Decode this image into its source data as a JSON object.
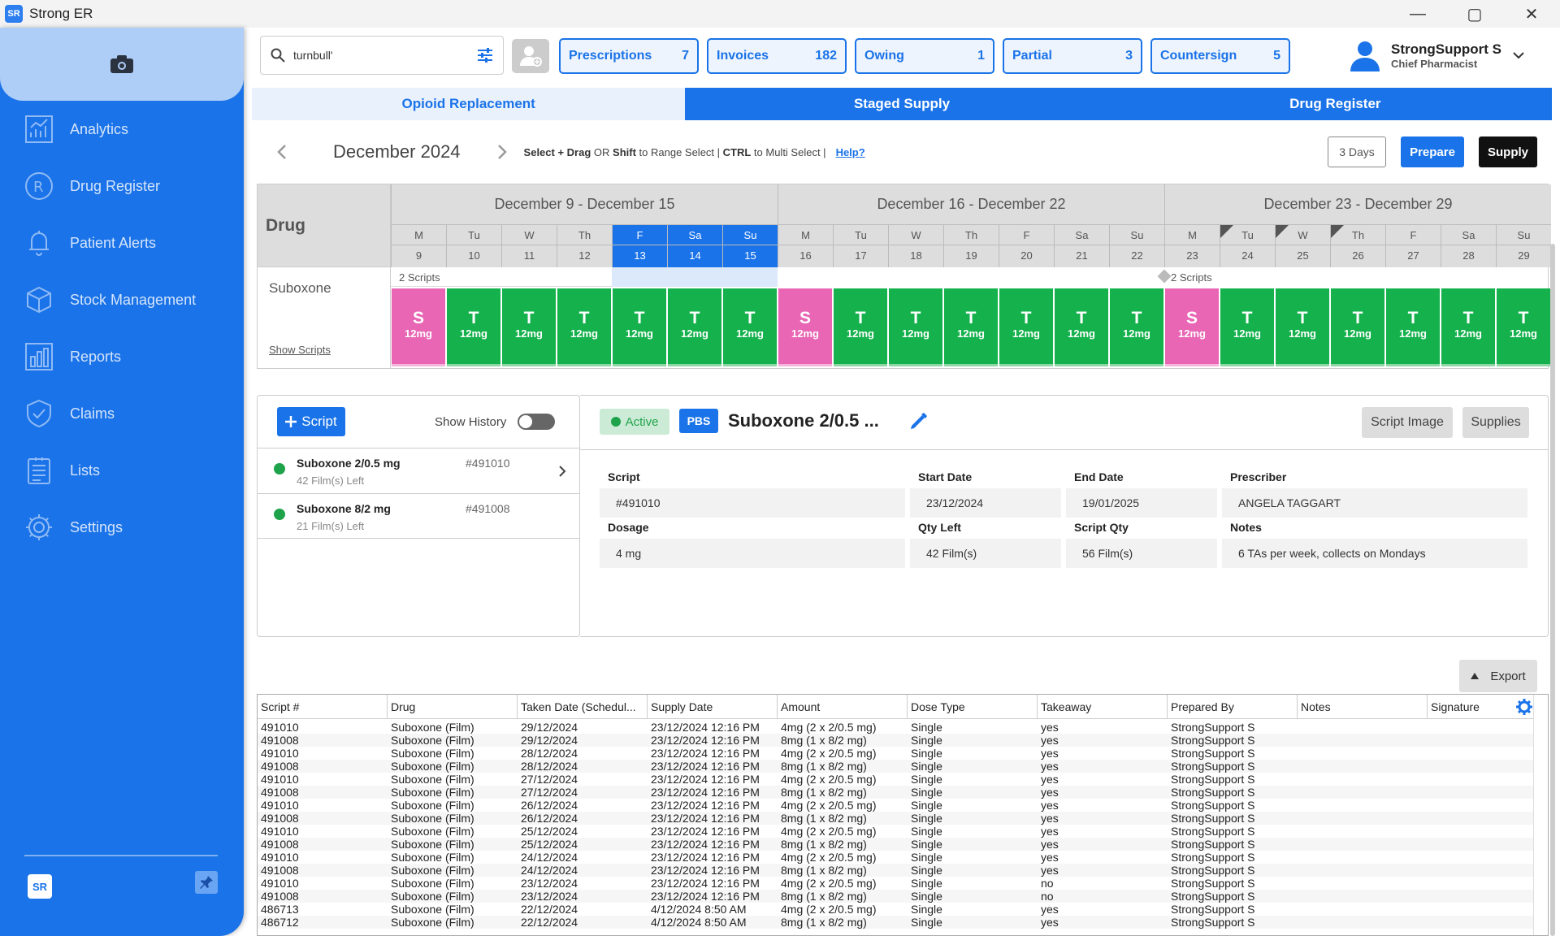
{
  "window": {
    "title": "Strong ER",
    "logo": "SR",
    "min": "—",
    "max": "▢",
    "close": "✕"
  },
  "sidebar": {
    "items": [
      {
        "label": "Analytics",
        "icon": "analytics-icon"
      },
      {
        "label": "Drug Register",
        "icon": "rx-icon"
      },
      {
        "label": "Patient Alerts",
        "icon": "bell-icon"
      },
      {
        "label": "Stock Management",
        "icon": "box-icon"
      },
      {
        "label": "Reports",
        "icon": "bar-chart-icon"
      },
      {
        "label": "Claims",
        "icon": "shield-check-icon"
      },
      {
        "label": "Lists",
        "icon": "list-icon"
      },
      {
        "label": "Settings",
        "icon": "gear-icon"
      }
    ],
    "logo": "SR"
  },
  "search": {
    "value": "turnbull'"
  },
  "pills": [
    {
      "label": "Prescriptions",
      "count": "7"
    },
    {
      "label": "Invoices",
      "count": "182"
    },
    {
      "label": "Owing",
      "count": "1"
    },
    {
      "label": "Partial",
      "count": "3"
    },
    {
      "label": "Countersign",
      "count": "5"
    }
  ],
  "user": {
    "name": "StrongSupport S",
    "role": "Chief Pharmacist"
  },
  "tabs": [
    "Opioid Replacement",
    "Staged Supply",
    "Drug Register"
  ],
  "calendar": {
    "month": "December 2024",
    "hint_a": "Select + Drag",
    "hint_b": " OR ",
    "hint_c": "Shift",
    "hint_d": " to Range Select | ",
    "hint_e": "CTRL",
    "hint_f": " to Multi Select | ",
    "help": "Help?",
    "days_btn": "3  Days",
    "prepare": "Prepare",
    "supply": "Supply",
    "drug_header": "Drug",
    "drug_name": "Suboxone",
    "show_scripts": "Show Scripts",
    "scripts_a": "2 Scripts",
    "scripts_b": "2 Scripts",
    "weeks": [
      "December 9 - December 15",
      "December 16 - December 22",
      "December 23 - December 29"
    ],
    "days": [
      {
        "d": "M",
        "n": "9"
      },
      {
        "d": "Tu",
        "n": "10"
      },
      {
        "d": "W",
        "n": "11"
      },
      {
        "d": "Th",
        "n": "12"
      },
      {
        "d": "F",
        "n": "13"
      },
      {
        "d": "Sa",
        "n": "14"
      },
      {
        "d": "Su",
        "n": "15"
      },
      {
        "d": "M",
        "n": "16"
      },
      {
        "d": "Tu",
        "n": "17"
      },
      {
        "d": "W",
        "n": "18"
      },
      {
        "d": "Th",
        "n": "19"
      },
      {
        "d": "F",
        "n": "20"
      },
      {
        "d": "Sa",
        "n": "21"
      },
      {
        "d": "Su",
        "n": "22"
      },
      {
        "d": "M",
        "n": "23"
      },
      {
        "d": "Tu",
        "n": "24"
      },
      {
        "d": "W",
        "n": "25"
      },
      {
        "d": "Th",
        "n": "26"
      },
      {
        "d": "F",
        "n": "27"
      },
      {
        "d": "Sa",
        "n": "28"
      },
      {
        "d": "Su",
        "n": "29"
      }
    ],
    "cells": [
      "S",
      "T",
      "T",
      "T",
      "T",
      "T",
      "T",
      "S",
      "T",
      "T",
      "T",
      "T",
      "T",
      "T",
      "S",
      "T",
      "T",
      "T",
      "T",
      "T",
      "T"
    ],
    "dose": "12mg"
  },
  "scripts_panel": {
    "add": "Script",
    "history": "Show History",
    "items": [
      {
        "name": "Suboxone 2/0.5 mg",
        "qty": "42 Film(s) Left",
        "id": "#491010"
      },
      {
        "name": "Suboxone 8/2 mg",
        "qty": "21 Film(s) Left",
        "id": "#491008"
      }
    ]
  },
  "detail": {
    "status": "Active",
    "pbs": "PBS",
    "name": "Suboxone 2/0.5 ...",
    "script_image": "Script Image",
    "supplies": "Supplies",
    "fields": {
      "script_l": "Script",
      "script_v": "#491010",
      "start_l": "Start Date",
      "start_v": "23/12/2024",
      "end_l": "End Date",
      "end_v": "19/01/2025",
      "prescriber_l": "Prescriber",
      "prescriber_v": "ANGELA TAGGART",
      "dosage_l": "Dosage",
      "dosage_v": "4 mg",
      "qty_l": "Qty Left",
      "qty_v": "42 Film(s)",
      "sqty_l": "Script Qty",
      "sqty_v": "56 Film(s)",
      "notes_l": "Notes",
      "notes_v": "6 TAs per week, collects on Mondays"
    }
  },
  "export": "Export",
  "table": {
    "headers": [
      "Script #",
      "Drug",
      "Taken Date (Schedul...",
      "Supply Date",
      "Amount",
      "Dose Type",
      "Takeaway",
      "Prepared By",
      "Notes",
      "Signature"
    ],
    "rows": [
      [
        "491010",
        "Suboxone (Film)",
        "29/12/2024",
        "23/12/2024 12:16 PM",
        "4mg (2 x 2/0.5 mg)",
        "Single",
        "yes",
        "StrongSupport S"
      ],
      [
        "491008",
        "Suboxone (Film)",
        "29/12/2024",
        "23/12/2024 12:16 PM",
        "8mg (1 x 8/2 mg)",
        "Single",
        "yes",
        "StrongSupport S"
      ],
      [
        "491010",
        "Suboxone (Film)",
        "28/12/2024",
        "23/12/2024 12:16 PM",
        "4mg (2 x 2/0.5 mg)",
        "Single",
        "yes",
        "StrongSupport S"
      ],
      [
        "491008",
        "Suboxone (Film)",
        "28/12/2024",
        "23/12/2024 12:16 PM",
        "8mg (1 x 8/2 mg)",
        "Single",
        "yes",
        "StrongSupport S"
      ],
      [
        "491010",
        "Suboxone (Film)",
        "27/12/2024",
        "23/12/2024 12:16 PM",
        "4mg (2 x 2/0.5 mg)",
        "Single",
        "yes",
        "StrongSupport S"
      ],
      [
        "491008",
        "Suboxone (Film)",
        "27/12/2024",
        "23/12/2024 12:16 PM",
        "8mg (1 x 8/2 mg)",
        "Single",
        "yes",
        "StrongSupport S"
      ],
      [
        "491010",
        "Suboxone (Film)",
        "26/12/2024",
        "23/12/2024 12:16 PM",
        "4mg (2 x 2/0.5 mg)",
        "Single",
        "yes",
        "StrongSupport S"
      ],
      [
        "491008",
        "Suboxone (Film)",
        "26/12/2024",
        "23/12/2024 12:16 PM",
        "8mg (1 x 8/2 mg)",
        "Single",
        "yes",
        "StrongSupport S"
      ],
      [
        "491010",
        "Suboxone (Film)",
        "25/12/2024",
        "23/12/2024 12:16 PM",
        "4mg (2 x 2/0.5 mg)",
        "Single",
        "yes",
        "StrongSupport S"
      ],
      [
        "491008",
        "Suboxone (Film)",
        "25/12/2024",
        "23/12/2024 12:16 PM",
        "8mg (1 x 8/2 mg)",
        "Single",
        "yes",
        "StrongSupport S"
      ],
      [
        "491010",
        "Suboxone (Film)",
        "24/12/2024",
        "23/12/2024 12:16 PM",
        "4mg (2 x 2/0.5 mg)",
        "Single",
        "yes",
        "StrongSupport S"
      ],
      [
        "491008",
        "Suboxone (Film)",
        "24/12/2024",
        "23/12/2024 12:16 PM",
        "8mg (1 x 8/2 mg)",
        "Single",
        "yes",
        "StrongSupport S"
      ],
      [
        "491010",
        "Suboxone (Film)",
        "23/12/2024",
        "23/12/2024 12:16 PM",
        "4mg (2 x 2/0.5 mg)",
        "Single",
        "no",
        "StrongSupport S"
      ],
      [
        "491008",
        "Suboxone (Film)",
        "23/12/2024",
        "23/12/2024 12:16 PM",
        "8mg (1 x 8/2 mg)",
        "Single",
        "no",
        "StrongSupport S"
      ],
      [
        "486713",
        "Suboxone (Film)",
        "22/12/2024",
        "4/12/2024 8:50 AM",
        "4mg (2 x 2/0.5 mg)",
        "Single",
        "yes",
        "StrongSupport S"
      ],
      [
        "486712",
        "Suboxone (Film)",
        "22/12/2024",
        "4/12/2024 8:50 AM",
        "8mg (1 x 8/2 mg)",
        "Single",
        "yes",
        "StrongSupport S"
      ]
    ]
  }
}
